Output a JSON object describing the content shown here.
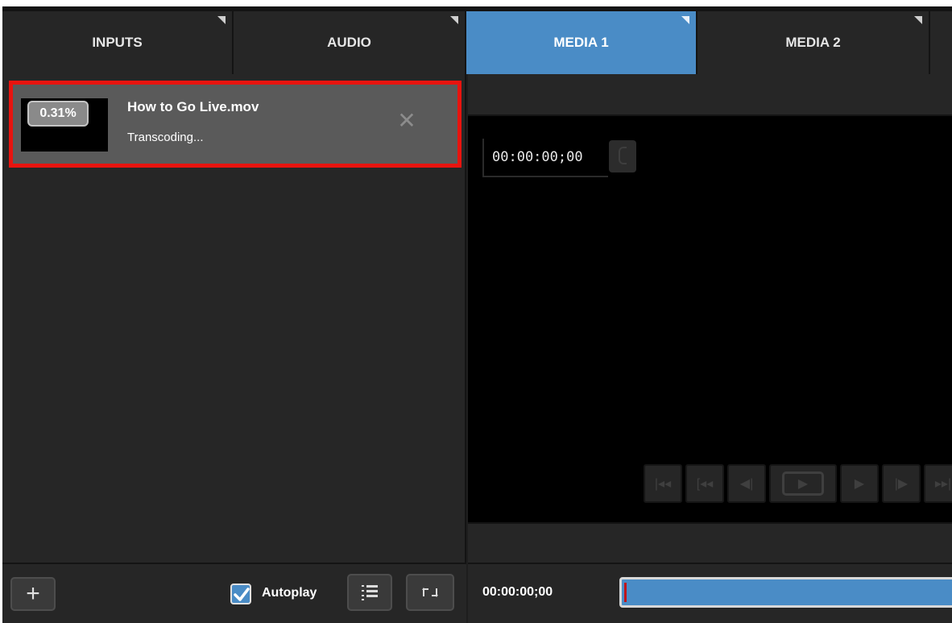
{
  "tabs": [
    {
      "label": "INPUTS",
      "active": false
    },
    {
      "label": "AUDIO",
      "active": false
    },
    {
      "label": "MEDIA 1",
      "active": true
    },
    {
      "label": "MEDIA 2",
      "active": false
    }
  ],
  "media_list": {
    "items": [
      {
        "title": "How to Go Live.mov",
        "status": "Transcoding...",
        "progress": "0.31%",
        "close_icon": "close-icon"
      }
    ],
    "highlight_color": "#e8140f"
  },
  "left_footer": {
    "add_icon": "plus-icon",
    "autoplay_label": "Autoplay",
    "autoplay_checked": true,
    "list_icon": "playlist-icon",
    "loop_icon": "loop-icon"
  },
  "player": {
    "timecode": "00:00:00;00",
    "transport_icons": [
      "skip-to-start-icon",
      "rewind-icon",
      "step-back-icon",
      "play-clip-icon",
      "play-icon",
      "step-forward-icon",
      "skip-to-end-icon"
    ]
  },
  "right_footer": {
    "timecode": "00:00:00;00"
  },
  "colors": {
    "accent": "#4a8cc6",
    "panel": "#262626",
    "background": "#1e1e1e"
  }
}
